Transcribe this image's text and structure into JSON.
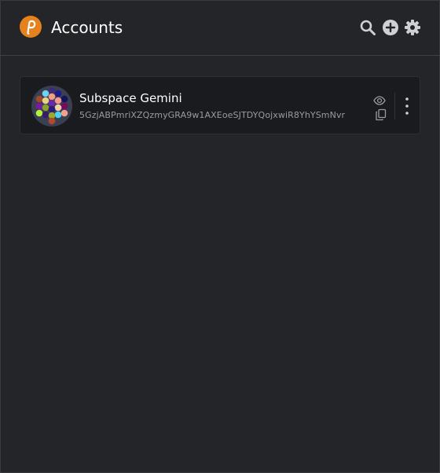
{
  "header": {
    "title": "Accounts",
    "icons": [
      "polkadot-logo",
      "search-icon",
      "add-icon",
      "settings-icon"
    ]
  },
  "accounts": [
    {
      "name": "Subspace Gemini",
      "address": "5GzjABPmriXZQzmyGRA9w1AXEoeSJTDYQojxwiR8YhYSmNvr",
      "actions": [
        "show-icon",
        "copy-icon",
        "more-menu-icon"
      ]
    }
  ],
  "colors": {
    "background": "#242528",
    "card": "#1a1b1f",
    "accent": "#e6821e",
    "icon": "#cfd0d3",
    "address_text": "#9a9ba0"
  }
}
